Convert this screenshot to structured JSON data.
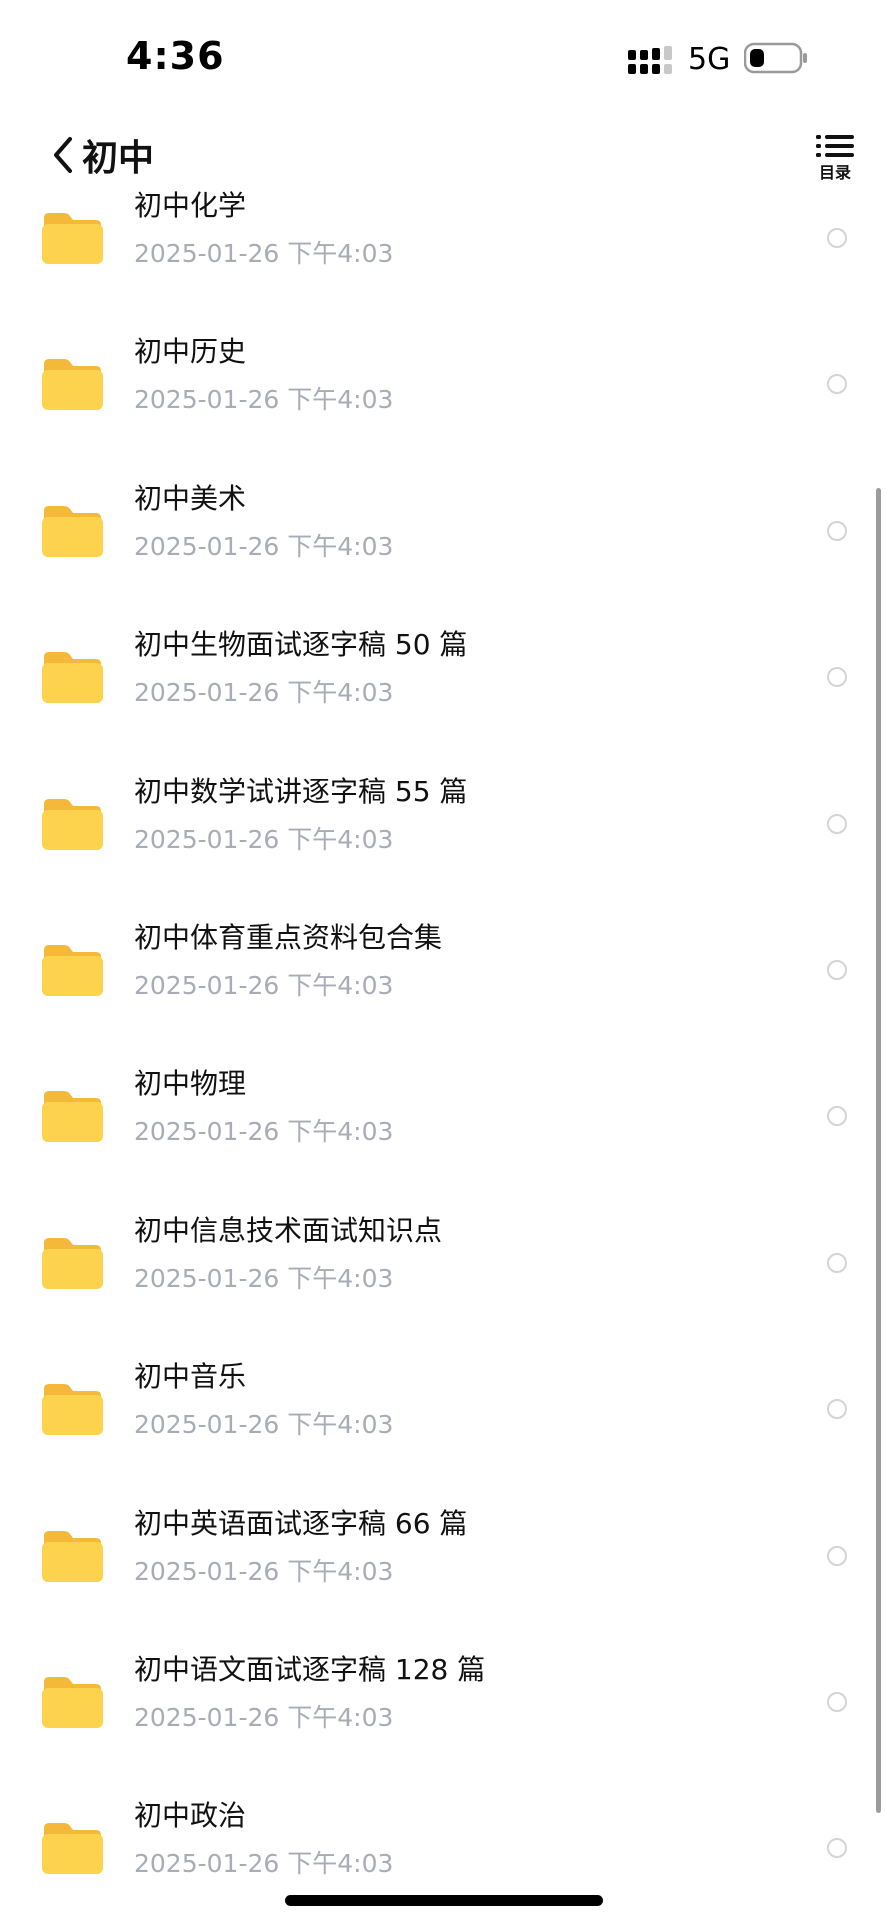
{
  "status_bar": {
    "time": "4:36",
    "network": "5G",
    "signal_icon": "cellular-signal-icon",
    "battery_icon": "battery-icon"
  },
  "nav": {
    "back_icon": "chevron-left-icon",
    "title": "初中",
    "toc_icon": "list-icon",
    "toc_label": "目录"
  },
  "file_list": {
    "items": [
      {
        "name": "初中化学",
        "date": "2025-01-26 下午4:03",
        "icon": "folder-icon"
      },
      {
        "name": "初中历史",
        "date": "2025-01-26 下午4:03",
        "icon": "folder-icon"
      },
      {
        "name": "初中美术",
        "date": "2025-01-26 下午4:03",
        "icon": "folder-icon"
      },
      {
        "name": "初中生物面试逐字稿 50 篇",
        "date": "2025-01-26 下午4:03",
        "icon": "folder-icon"
      },
      {
        "name": "初中数学试讲逐字稿 55 篇",
        "date": "2025-01-26 下午4:03",
        "icon": "folder-icon"
      },
      {
        "name": "初中体育重点资料包合集",
        "date": "2025-01-26 下午4:03",
        "icon": "folder-icon"
      },
      {
        "name": "初中物理",
        "date": "2025-01-26 下午4:03",
        "icon": "folder-icon"
      },
      {
        "name": "初中信息技术面试知识点",
        "date": "2025-01-26 下午4:03",
        "icon": "folder-icon"
      },
      {
        "name": "初中音乐",
        "date": "2025-01-26 下午4:03",
        "icon": "folder-icon"
      },
      {
        "name": "初中英语面试逐字稿 66 篇",
        "date": "2025-01-26 下午4:03",
        "icon": "folder-icon"
      },
      {
        "name": "初中语文面试逐字稿 128 篇",
        "date": "2025-01-26 下午4:03",
        "icon": "folder-icon"
      },
      {
        "name": "初中政治",
        "date": "2025-01-26 下午4:03",
        "icon": "folder-icon"
      }
    ]
  },
  "colors": {
    "folder_body": "#fdd24c",
    "folder_tab": "#f5b93a",
    "date_text": "#a9acb5",
    "radio_border": "#d2d4d8"
  }
}
